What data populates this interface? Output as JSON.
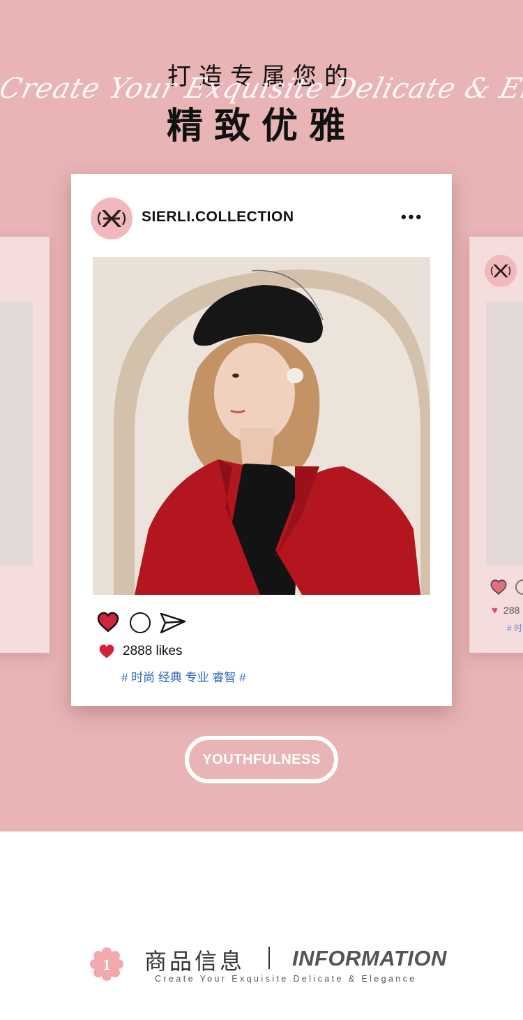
{
  "header": {
    "title_small": "打造专属您的",
    "title_script": "Create Your Exquisite Delicate & Elegance",
    "title_large": "精致优雅"
  },
  "post": {
    "username": "SIERLI.COLLECTION",
    "more_label": "•••",
    "likes_text": "2888 likes",
    "tags": "# 时尚 经典 专业 睿智 #"
  },
  "side_post": {
    "likes_text": "288",
    "tags": "# 时"
  },
  "badge": {
    "label": "YOUTHFULNESS"
  },
  "info": {
    "number": "1",
    "title_cn": "商品信息",
    "title_en": "INFORMATION",
    "subtitle": "Create Your Exquisite Delicate & Elegance"
  },
  "colors": {
    "hero_bg": "#e8b4b6",
    "card_bg": "#ffffff",
    "heart": "#d0243d",
    "tag_blue": "#2f65b8",
    "avatar_pink": "#f2b9bd"
  },
  "icons": {
    "avatar": "brand-monogram-icon",
    "like": "heart-icon",
    "comment": "comment-circle-icon",
    "share": "paper-plane-icon",
    "more": "more-dots-icon",
    "info": "flower-number-icon"
  }
}
